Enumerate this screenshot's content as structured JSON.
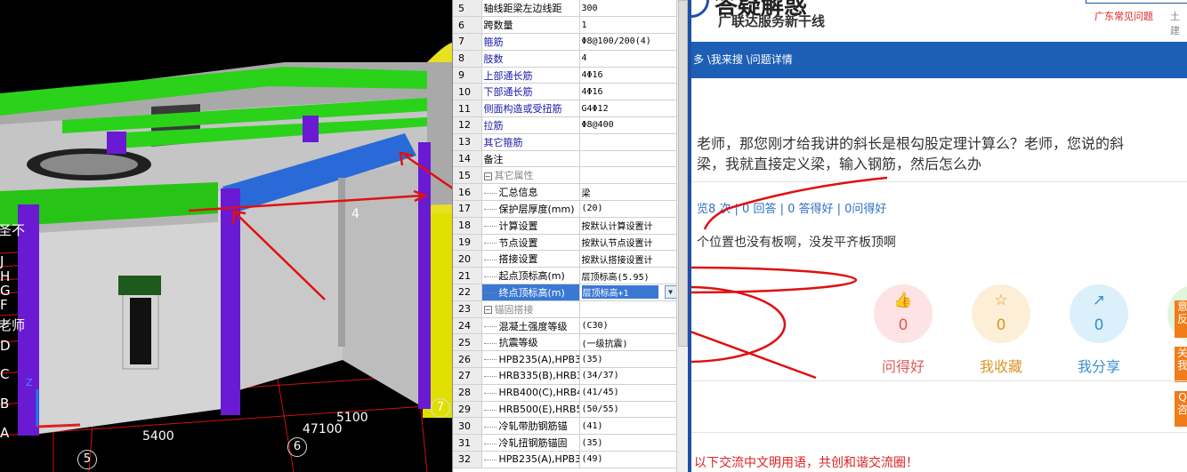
{
  "viewport": {
    "axis_labels": [
      "J",
      "H",
      "G",
      "F",
      "D",
      "C",
      "B",
      "A"
    ],
    "left_text": [
      "圣不",
      "老师"
    ],
    "dimensions": [
      "5400",
      "47100",
      "5100",
      "4"
    ],
    "grid_circles": [
      "5",
      "6",
      "7"
    ],
    "coord_axis": "Z"
  },
  "property_rows": [
    {
      "num": "5",
      "name": "轴线距梁左边线距",
      "value": "300",
      "style": "dark"
    },
    {
      "num": "6",
      "name": "跨数量",
      "value": "1",
      "style": "dark"
    },
    {
      "num": "7",
      "name": "箍筋",
      "value": "Φ8@100/200(4)",
      "style": "blue"
    },
    {
      "num": "8",
      "name": "肢数",
      "value": "4",
      "style": "blue"
    },
    {
      "num": "9",
      "name": "上部通长筋",
      "value": "4Φ16",
      "style": "blue"
    },
    {
      "num": "10",
      "name": "下部通长筋",
      "value": "4Φ16",
      "style": "blue"
    },
    {
      "num": "11",
      "name": "侧面构造或受扭筋",
      "value": "G4Φ12",
      "style": "blue"
    },
    {
      "num": "12",
      "name": "拉筋",
      "value": "Φ8@400",
      "style": "blue"
    },
    {
      "num": "13",
      "name": "其它箍筋",
      "value": "",
      "style": "blue"
    },
    {
      "num": "14",
      "name": "备注",
      "value": "",
      "style": "dark"
    },
    {
      "num": "15",
      "name": "其它属性",
      "value": "",
      "style": "grey",
      "group": "−"
    },
    {
      "num": "16",
      "name": "汇总信息",
      "value": "梁",
      "style": "dark",
      "indent": true
    },
    {
      "num": "17",
      "name": "保护层厚度(mm)",
      "value": "(20)",
      "style": "dark",
      "indent": true
    },
    {
      "num": "18",
      "name": "计算设置",
      "value": "按默认计算设置计",
      "style": "dark",
      "indent": true
    },
    {
      "num": "19",
      "name": "节点设置",
      "value": "按默认节点设置计",
      "style": "dark",
      "indent": true
    },
    {
      "num": "20",
      "name": "搭接设置",
      "value": "按默认搭接设置计",
      "style": "dark",
      "indent": true
    },
    {
      "num": "21",
      "name": "起点顶标高(m)",
      "value": "层顶标高(5.95)",
      "style": "dark",
      "indent": true
    },
    {
      "num": "22",
      "name": "终点顶标高(m)",
      "value": "层顶标高+1",
      "style": "dark",
      "indent": true,
      "selected": true
    },
    {
      "num": "23",
      "name": "锚固搭接",
      "value": "",
      "style": "grey",
      "group": "−"
    },
    {
      "num": "24",
      "name": "混凝土强度等级",
      "value": "(C30)",
      "style": "dark",
      "indent": true
    },
    {
      "num": "25",
      "name": "抗震等级",
      "value": "(一级抗震)",
      "style": "dark",
      "indent": true
    },
    {
      "num": "26",
      "name": "HPB235(A),HPB3",
      "value": "(35)",
      "style": "dark",
      "indent": true
    },
    {
      "num": "27",
      "name": "HRB335(B),HRB3",
      "value": "(34/37)",
      "style": "dark",
      "indent": true
    },
    {
      "num": "28",
      "name": "HRB400(C),HRB4",
      "value": "(41/45)",
      "style": "dark",
      "indent": true
    },
    {
      "num": "29",
      "name": "HRB500(E),HRB5",
      "value": "(50/55)",
      "style": "dark",
      "indent": true
    },
    {
      "num": "30",
      "name": "冷轧带肋钢筋锚",
      "value": "(41)",
      "style": "dark",
      "indent": true
    },
    {
      "num": "31",
      "name": "冷轧扭钢筋锚固",
      "value": "(35)",
      "style": "dark",
      "indent": true
    },
    {
      "num": "32",
      "name": "HPB235(A),HPB3",
      "value": "(49)",
      "style": "dark",
      "indent": true
    }
  ],
  "web": {
    "logo_big": "答疑解惑",
    "logo_sub": "广联达服务新干线",
    "top_link": "广东常见问题",
    "top_link2": "土建",
    "breadcrumb": "多 \\我来搜 \\问题详情",
    "question_line1": "老师，那您刚才给我讲的斜长是根勾股定理计算么？老师，您说的斜",
    "question_line2": "梁，我就直接定义梁，输入钢筋，然后怎么办",
    "stats": "览8 次 | 0 回答 | 0 答得好 | 0问得好",
    "answer": "个位置也没有板啊，没发平齐板顶啊",
    "actions": [
      {
        "label": "问得好",
        "count": "0",
        "icon": "thumb-icon",
        "color": "#e05a5a",
        "bg": "#fde3e3"
      },
      {
        "label": "我收藏",
        "count": "0",
        "icon": "star-icon",
        "color": "#d9962a",
        "bg": "#fdefd7"
      },
      {
        "label": "我分享",
        "count": "0",
        "icon": "share-icon",
        "color": "#3a8fd0",
        "bg": "#dcf0fb"
      }
    ],
    "side_tabs": [
      "意反",
      "关我",
      "Q咨"
    ],
    "footer_note": "以下交流中文明用语，共创和谐交流圈！"
  }
}
